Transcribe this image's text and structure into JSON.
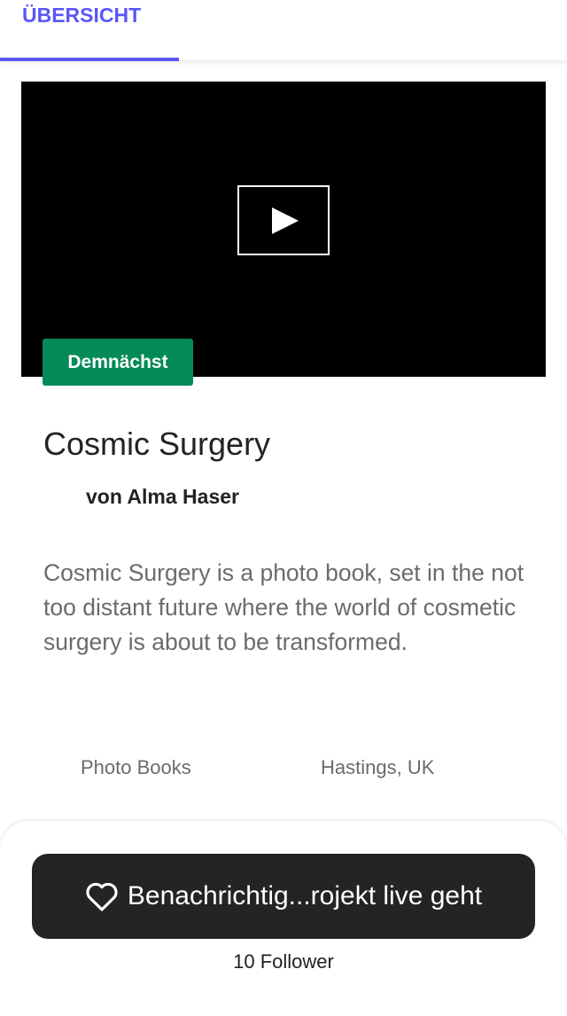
{
  "tabs": [
    {
      "label": "ÜBERSICHT",
      "active": true
    }
  ],
  "accent_color": "#5a56f5",
  "video": {
    "icon": "play-icon"
  },
  "badge": {
    "label": "Demnächst",
    "color": "#038a58"
  },
  "project": {
    "title": "Cosmic Surgery",
    "author": "von Alma Haser",
    "description": "Cosmic Surgery is a photo book, set in the not too distant future where the world of cosmetic surgery is about to be transformed.",
    "category": "Photo Books",
    "location": "Hastings, UK"
  },
  "footer": {
    "notify_label": "Benachrichtig...rojekt live geht",
    "notify_icon": "heart-icon",
    "followers": "10 Follower"
  }
}
